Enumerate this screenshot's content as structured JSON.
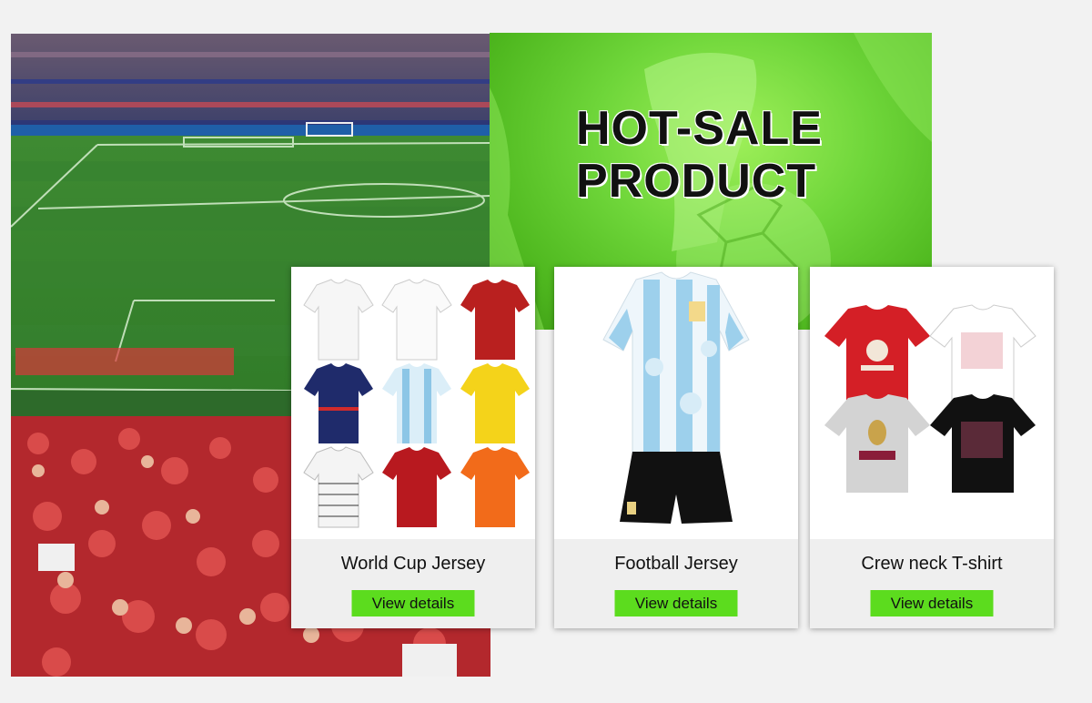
{
  "banner": {
    "title_line1": "HOT-SALE",
    "title_line2": "PRODUCT"
  },
  "products": [
    {
      "name": "World Cup Jersey",
      "button": "View details"
    },
    {
      "name": "Football Jersey",
      "button": "View details"
    },
    {
      "name": "Crew neck T-shirt",
      "button": "View details"
    }
  ],
  "colors": {
    "accent_green": "#5cdc1e",
    "banner_green": "#6fd63a",
    "card_footer": "#efefef"
  },
  "images": {
    "stadium": "stadium-crowd-photo",
    "card1": "jersey-grid-image",
    "card2": "argentina-kit-image",
    "card3": "world-cup-tshirts-image"
  }
}
